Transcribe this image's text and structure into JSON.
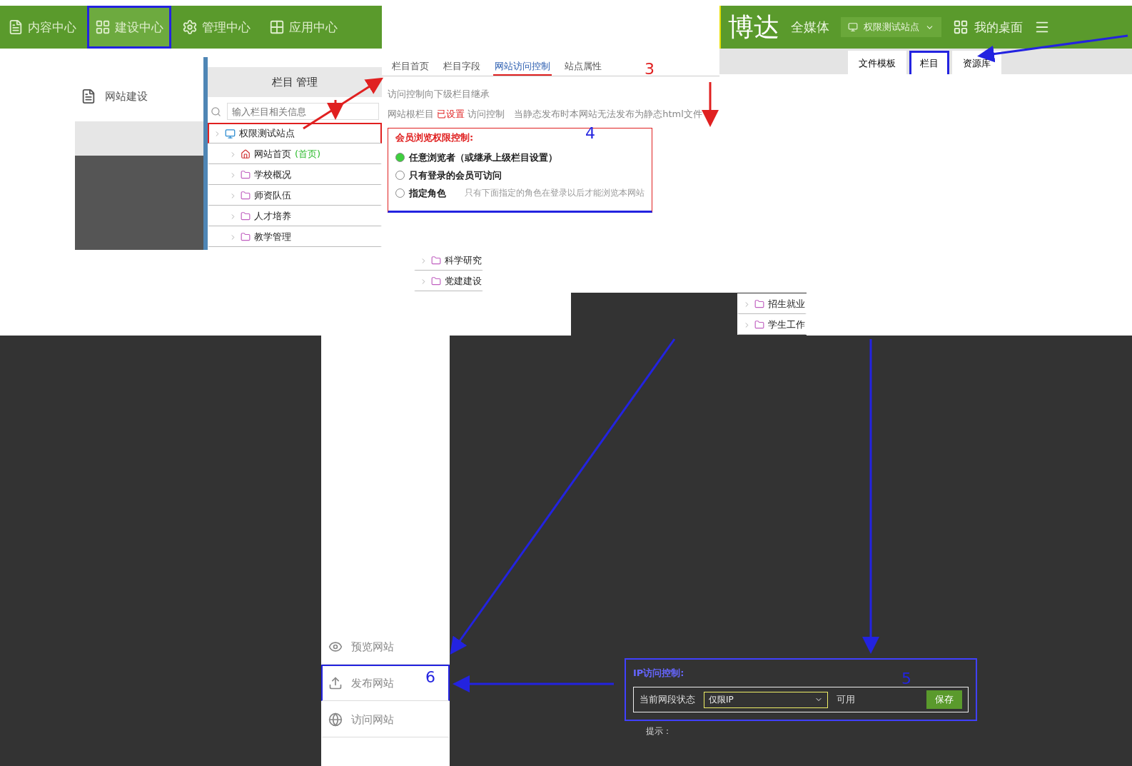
{
  "main_nav": [
    {
      "label": "内容中心",
      "selected": false
    },
    {
      "label": "建设中心",
      "selected": true
    },
    {
      "label": "管理中心",
      "selected": false
    },
    {
      "label": "应用中心",
      "selected": false
    }
  ],
  "sidebar": {
    "item": "网站建设"
  },
  "column_panel": {
    "title": "栏目 管理",
    "search_placeholder": "输入栏目相关信息",
    "tree": [
      {
        "label": "权限测试站点",
        "kind": "site",
        "selected": true,
        "children": [
          {
            "label": "网站首页",
            "tag": "(首页)",
            "kind": "home",
            "selected": false
          },
          {
            "label": "学校概况",
            "kind": "folder",
            "selected": false
          },
          {
            "label": "师资队伍",
            "kind": "folder",
            "selected": false
          },
          {
            "label": "人才培养",
            "kind": "folder",
            "selected": false
          },
          {
            "label": "教学管理",
            "kind": "folder",
            "selected": false
          },
          {
            "label": "科学研究",
            "kind": "folder",
            "selected": false
          },
          {
            "label": "党建建设",
            "kind": "folder",
            "selected": false
          },
          {
            "label": "招生就业",
            "kind": "folder",
            "selected": false
          },
          {
            "label": "学生工作",
            "kind": "folder",
            "selected": false
          }
        ]
      }
    ]
  },
  "settings_tabs": [
    {
      "label": "栏目首页",
      "selected": false
    },
    {
      "label": "栏目字段",
      "selected": false
    },
    {
      "label": "网站访问控制",
      "selected": true
    },
    {
      "label": "站点属性",
      "selected": false
    }
  ],
  "access": {
    "inherit_note": "访问控制向下级栏目继承",
    "status_prefix": "网站根栏目",
    "status_value": "已设置",
    "status_suffix": "访问控制",
    "static_note": "当静态发布时本网站无法发布为静态html文件",
    "group_title": "会员浏览权限控制:",
    "options": [
      {
        "label": "任意浏览者（或继承上级栏目设置）",
        "selected": true
      },
      {
        "label": "只有登录的会员可访问",
        "selected": false
      },
      {
        "label": "指定角色",
        "selected": false,
        "hint": "只有下面指定的角色在登录以后才能浏览本网站"
      }
    ]
  },
  "header": {
    "logo": "博达",
    "subtitle": "全媒体",
    "site_select": "权限测试站点",
    "desktop": "我的桌面"
  },
  "header_tabs": [
    {
      "label": "文件模板",
      "selected": false
    },
    {
      "label": "栏目",
      "selected": true
    },
    {
      "label": "资源库",
      "selected": false
    }
  ],
  "site_menu": [
    {
      "label": "预览网站",
      "selected": false
    },
    {
      "label": "发布网站",
      "selected": true
    },
    {
      "label": "访问网站",
      "selected": false
    }
  ],
  "ip_panel": {
    "title": "IP访问控制:",
    "row_label": "当前网段状态",
    "select_value": "仅限IP",
    "state": "可用",
    "save": "保存",
    "note": "提示："
  },
  "steps": [
    {
      "number": "3"
    },
    {
      "number": "4"
    },
    {
      "number": "5"
    },
    {
      "number": "6"
    }
  ]
}
